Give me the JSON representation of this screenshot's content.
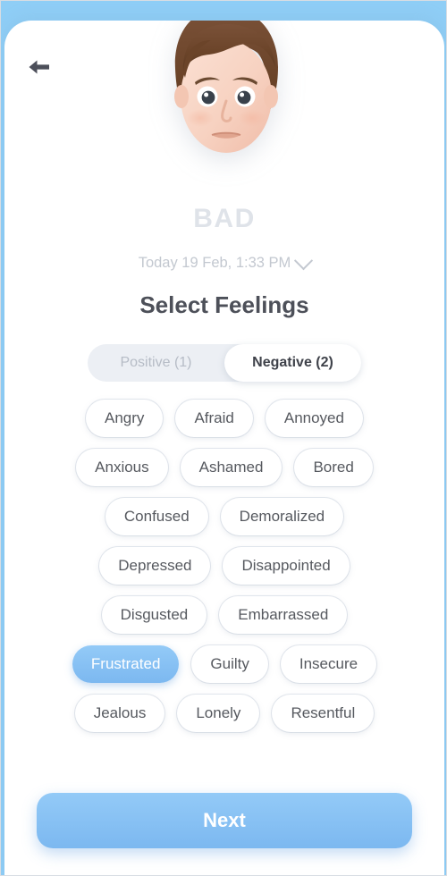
{
  "theme": {
    "header_blue": "#8fcef6",
    "accent_blue": "#7cb8f0",
    "chip_text": "#56595f",
    "muted_text": "#c3c8d0"
  },
  "header": {
    "back_icon": "arrow-left-icon",
    "avatar_icon": "avatar-face-sad",
    "mood_label": "BAD",
    "date_label": "Today 19 Feb, 1:33 PM",
    "date_chevron_icon": "chevron-down-icon"
  },
  "main": {
    "section_title": "Select Feelings",
    "tabs": [
      {
        "label": "Positive (1)",
        "active": false
      },
      {
        "label": "Negative (2)",
        "active": true
      }
    ],
    "chip_rows": [
      [
        {
          "label": "Angry",
          "selected": false
        },
        {
          "label": "Afraid",
          "selected": false
        },
        {
          "label": "Annoyed",
          "selected": false
        }
      ],
      [
        {
          "label": "Anxious",
          "selected": false
        },
        {
          "label": "Ashamed",
          "selected": false
        },
        {
          "label": "Bored",
          "selected": false
        }
      ],
      [
        {
          "label": "Confused",
          "selected": false
        },
        {
          "label": "Demoralized",
          "selected": false
        }
      ],
      [
        {
          "label": "Depressed",
          "selected": false
        },
        {
          "label": "Disappointed",
          "selected": false
        }
      ],
      [
        {
          "label": "Disgusted",
          "selected": false
        },
        {
          "label": "Embarrassed",
          "selected": false
        }
      ],
      [
        {
          "label": "Frustrated",
          "selected": true
        },
        {
          "label": "Guilty",
          "selected": false
        },
        {
          "label": "Insecure",
          "selected": false
        }
      ],
      [
        {
          "label": "Jealous",
          "selected": false
        },
        {
          "label": "Lonely",
          "selected": false
        },
        {
          "label": "Resentful",
          "selected": false
        }
      ]
    ]
  },
  "footer": {
    "next_label": "Next"
  }
}
